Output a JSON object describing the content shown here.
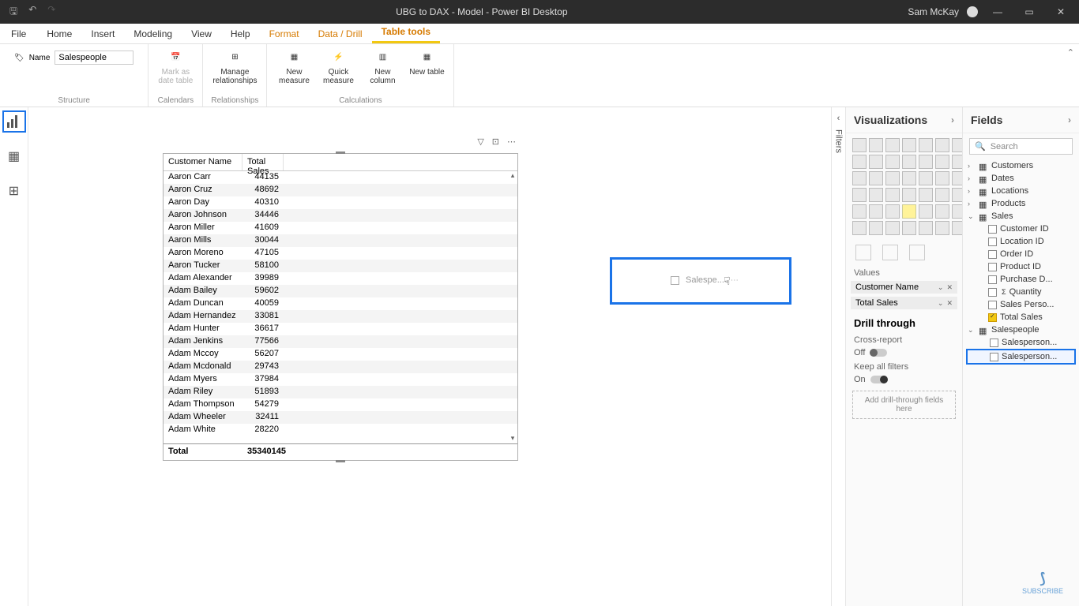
{
  "titlebar": {
    "title": "UBG to DAX - Model - Power BI Desktop",
    "user": "Sam McKay"
  },
  "ribbon": {
    "file": "File",
    "tabs": [
      "Home",
      "Insert",
      "Modeling",
      "View",
      "Help"
    ],
    "ctx_tabs": [
      "Format",
      "Data / Drill",
      "Table tools"
    ],
    "active_tab": "Table tools",
    "name_label": "Name",
    "name_value": "Salespeople",
    "groups": {
      "structure": "Structure",
      "calendars": "Calendars",
      "relationships": "Relationships",
      "calculations": "Calculations"
    },
    "items": {
      "mark_date": "Mark as date table",
      "manage_rel": "Manage relationships",
      "new_measure": "New measure",
      "quick_measure": "Quick measure",
      "new_column": "New column",
      "new_table": "New table"
    }
  },
  "table_visual": {
    "col1": "Customer Name",
    "col2": "Total Sales",
    "rows": [
      [
        "Aaron Carr",
        "44135"
      ],
      [
        "Aaron Cruz",
        "48692"
      ],
      [
        "Aaron Day",
        "40310"
      ],
      [
        "Aaron Johnson",
        "34446"
      ],
      [
        "Aaron Miller",
        "41609"
      ],
      [
        "Aaron Mills",
        "30044"
      ],
      [
        "Aaron Moreno",
        "47105"
      ],
      [
        "Aaron Tucker",
        "58100"
      ],
      [
        "Adam Alexander",
        "39989"
      ],
      [
        "Adam Bailey",
        "59602"
      ],
      [
        "Adam Duncan",
        "40059"
      ],
      [
        "Adam Hernandez",
        "33081"
      ],
      [
        "Adam Hunter",
        "36617"
      ],
      [
        "Adam Jenkins",
        "77566"
      ],
      [
        "Adam Mccoy",
        "56207"
      ],
      [
        "Adam Mcdonald",
        "29743"
      ],
      [
        "Adam Myers",
        "37984"
      ],
      [
        "Adam Riley",
        "51893"
      ],
      [
        "Adam Thompson",
        "54279"
      ],
      [
        "Adam Wheeler",
        "32411"
      ],
      [
        "Adam White",
        "28220"
      ]
    ],
    "total_label": "Total",
    "total_value": "35340145"
  },
  "slicer": {
    "placeholder": "Salespe..."
  },
  "viz_pane": {
    "title": "Visualizations",
    "values_label": "Values",
    "pill1": "Customer Name",
    "pill2": "Total Sales",
    "drill_title": "Drill through",
    "cross_report": "Cross-report",
    "off": "Off",
    "keep_filters": "Keep all filters",
    "on": "On",
    "drop_hint": "Add drill-through fields here"
  },
  "fields_pane": {
    "title": "Fields",
    "search_placeholder": "Search",
    "tables": {
      "customers": "Customers",
      "dates": "Dates",
      "locations": "Locations",
      "products": "Products",
      "sales": "Sales",
      "salespeople": "Salespeople"
    },
    "sales_fields": [
      "Customer ID",
      "Location ID",
      "Order ID",
      "Product ID",
      "Purchase D...",
      "Quantity",
      "Sales Perso...",
      "Total Sales"
    ],
    "sp_fields": [
      "Salesperson...",
      "Salesperson..."
    ]
  },
  "filters_label": "Filters",
  "subscribe": "SUBSCRIBE"
}
